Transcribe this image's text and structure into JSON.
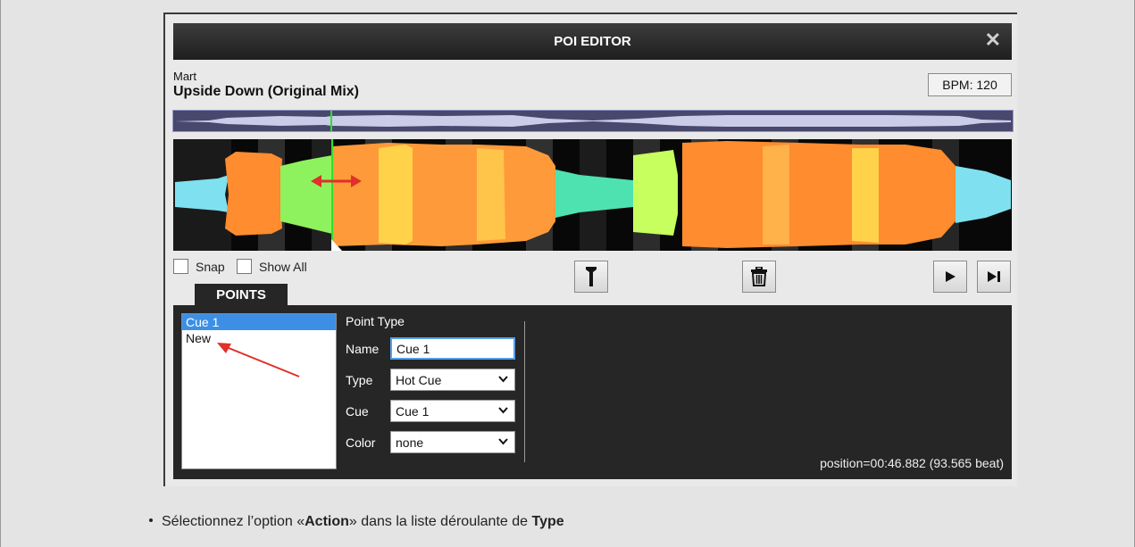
{
  "window": {
    "title": "POI EDITOR",
    "close_symbol": "✕"
  },
  "track": {
    "artist": "Mart",
    "title": "Upside Down (Original Mix)",
    "bpm_label": "BPM: 120"
  },
  "options": {
    "snap_label": "Snap",
    "show_all_label": "Show All"
  },
  "tabs": {
    "points_label": "POINTS"
  },
  "points_list": [
    {
      "label": "Cue 1",
      "selected": true
    },
    {
      "label": "New",
      "selected": false
    }
  ],
  "point_form": {
    "heading": "Point Type",
    "name_label": "Name",
    "name_value": "Cue 1",
    "type_label": "Type",
    "type_value": "Hot Cue",
    "cue_label": "Cue",
    "cue_value": "Cue 1",
    "color_label": "Color",
    "color_value": "none"
  },
  "status": {
    "position_text": "position=00:46.882 (93.565 beat)"
  },
  "instruction": {
    "prefix": "Sélectionnez l’option «",
    "bold1": "Action",
    "middle": "» dans la liste déroulante de ",
    "bold2": "Type"
  },
  "colors": {
    "titlebar": "#1e1e1e",
    "panel": "#262626",
    "selection": "#3d8fe6",
    "annotation_arrow": "#e0302a",
    "cursor_line": "#2ee02e"
  },
  "icons": {
    "filter_button": "funnel-icon",
    "delete_button": "trash-icon",
    "play_button": "play-icon",
    "next_button": "skip-next-icon"
  }
}
